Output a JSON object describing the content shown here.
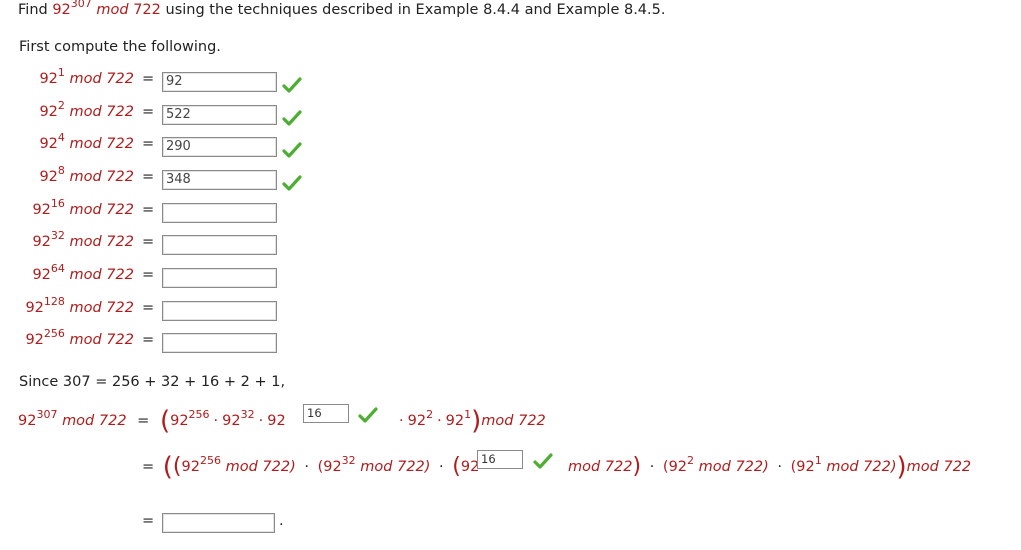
{
  "question": {
    "find": "Find",
    "base": "92",
    "exponent": "307",
    "mod_word": "mod",
    "modulus": "722",
    "rest": "using the techniques described in Example 8.4.4 and Example 8.4.5."
  },
  "first_compute": "First compute the following.",
  "rows": [
    {
      "base": "92",
      "exp": "1",
      "mod": "mod 722",
      "eq": "=",
      "value": "92",
      "correct": true
    },
    {
      "base": "92",
      "exp": "2",
      "mod": "mod 722",
      "eq": "=",
      "value": "522",
      "correct": true
    },
    {
      "base": "92",
      "exp": "4",
      "mod": "mod 722",
      "eq": "=",
      "value": "290",
      "correct": true
    },
    {
      "base": "92",
      "exp": "8",
      "mod": "mod 722",
      "eq": "=",
      "value": "348",
      "correct": true
    },
    {
      "base": "92",
      "exp": "16",
      "mod": "mod 722",
      "eq": "=",
      "value": "",
      "correct": false
    },
    {
      "base": "92",
      "exp": "32",
      "mod": "mod 722",
      "eq": "=",
      "value": "",
      "correct": false
    },
    {
      "base": "92",
      "exp": "64",
      "mod": "mod 722",
      "eq": "=",
      "value": "",
      "correct": false
    },
    {
      "base": "92",
      "exp": "128",
      "mod": "mod 722",
      "eq": "=",
      "value": "",
      "correct": false
    },
    {
      "base": "92",
      "exp": "256",
      "mod": "mod 722",
      "eq": "=",
      "value": "",
      "correct": false
    }
  ],
  "since": "Since 307 = 256 + 32 + 16 + 2 + 1,",
  "line1": {
    "lhs_base": "92",
    "lhs_exp": "307",
    "lhs_mod": "mod 722",
    "eq": "=",
    "t1_base": "92",
    "t1_exp": "256",
    "dot1": "·",
    "t2_base": "92",
    "t2_exp": "32",
    "dot2": "·",
    "t3_base": "92",
    "box_value": "16",
    "dot3": "·",
    "t4_base": "92",
    "t4_exp": "2",
    "dot4": "·",
    "t5_base": "92",
    "t5_exp": "1",
    "tail": "mod 722"
  },
  "line2": {
    "eq": "=",
    "a_base": "92",
    "a_exp": "256",
    "a_mod": "mod 722)",
    "dot1": "·",
    "b_open": "(92",
    "b_exp": "32",
    "b_mod": "mod 722)",
    "dot2": "·",
    "c_base": "92",
    "box_value": "16",
    "c_mod": "mod 722",
    "dot3": "·",
    "d_open": "(92",
    "d_exp": "2",
    "d_mod": "mod 722)",
    "dot4": "·",
    "e_open": "(92",
    "e_exp": "1",
    "e_mod": "mod 722)",
    "tail": "mod 722"
  },
  "line3": {
    "eq": "=",
    "value": "",
    "period": "."
  },
  "colors": {
    "accent_red": "#b01c1c",
    "check_green": "#4caf32"
  }
}
